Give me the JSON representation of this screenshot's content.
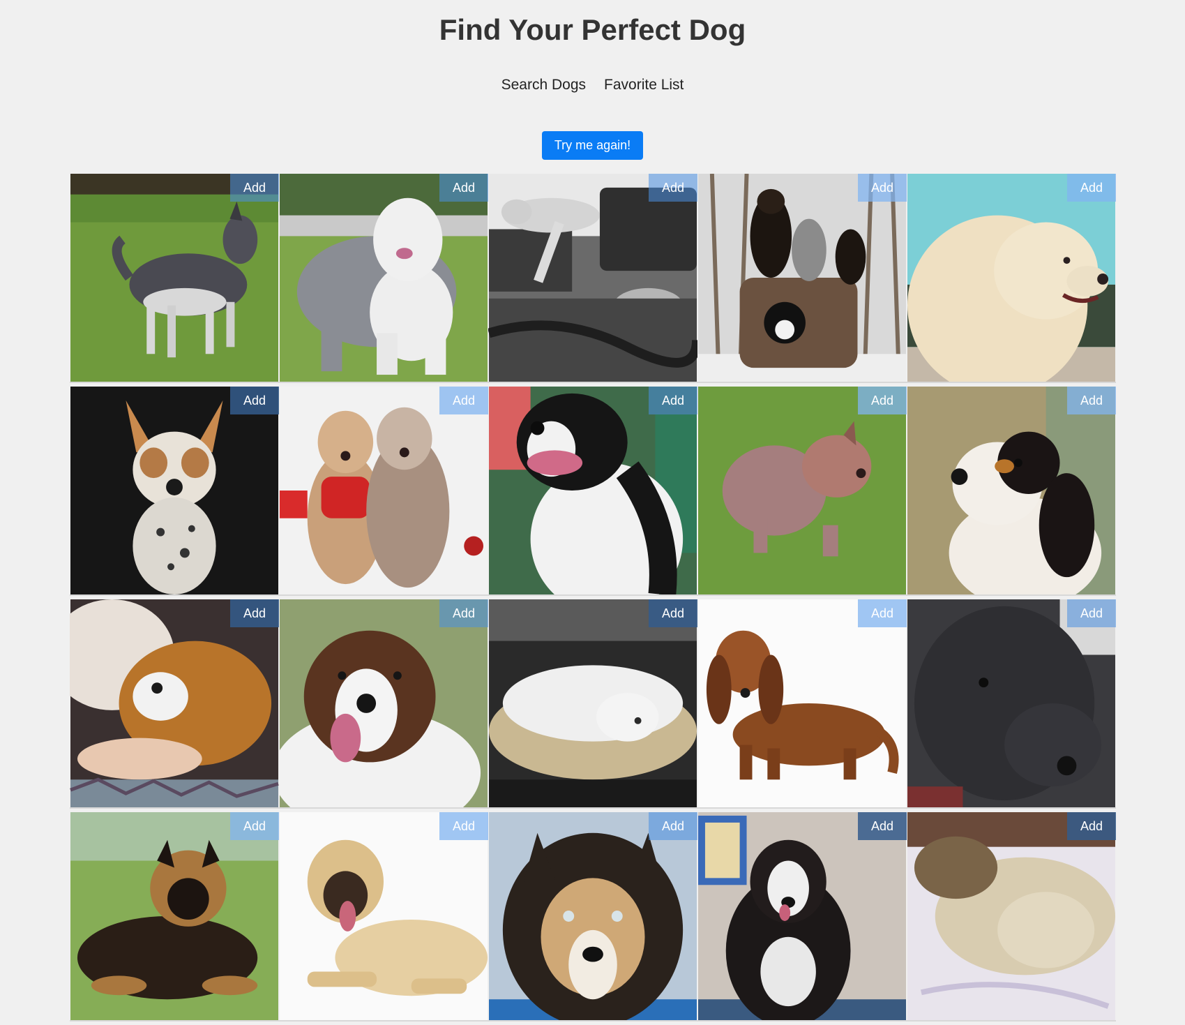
{
  "header": {
    "title": "Find Your Perfect Dog"
  },
  "nav": {
    "search_label": "Search Dogs",
    "favorites_label": "Favorite List"
  },
  "actions": {
    "retry_label": "Try me again!"
  },
  "gallery": {
    "add_label": "Add",
    "colors": {
      "button_blue": "#0a7cf5",
      "add_overlay": "#4a90e2"
    },
    "dogs": [
      {
        "scene": "husky-on-grass"
      },
      {
        "scene": "old-english-sheepdog"
      },
      {
        "scene": "beagle-and-cat-bw"
      },
      {
        "scene": "rottweilers-with-cats"
      },
      {
        "scene": "golden-retriever"
      },
      {
        "scene": "cattle-dog-black-bg"
      },
      {
        "scene": "two-bearded-collies"
      },
      {
        "scene": "border-collie"
      },
      {
        "scene": "fluffy-puppy-grass"
      },
      {
        "scene": "spaniel-tricolor"
      },
      {
        "scene": "sleeping-shepherd-puppy"
      },
      {
        "scene": "saint-bernard"
      },
      {
        "scene": "white-dog-in-bed"
      },
      {
        "scene": "dachshund-white-bg"
      },
      {
        "scene": "dark-terrier-closeup"
      },
      {
        "scene": "german-shepherd-puppy"
      },
      {
        "scene": "mastiff-lying"
      },
      {
        "scene": "husky-closeup"
      },
      {
        "scene": "malamute-indoors"
      },
      {
        "scene": "shih-tzu-on-bed"
      }
    ]
  }
}
